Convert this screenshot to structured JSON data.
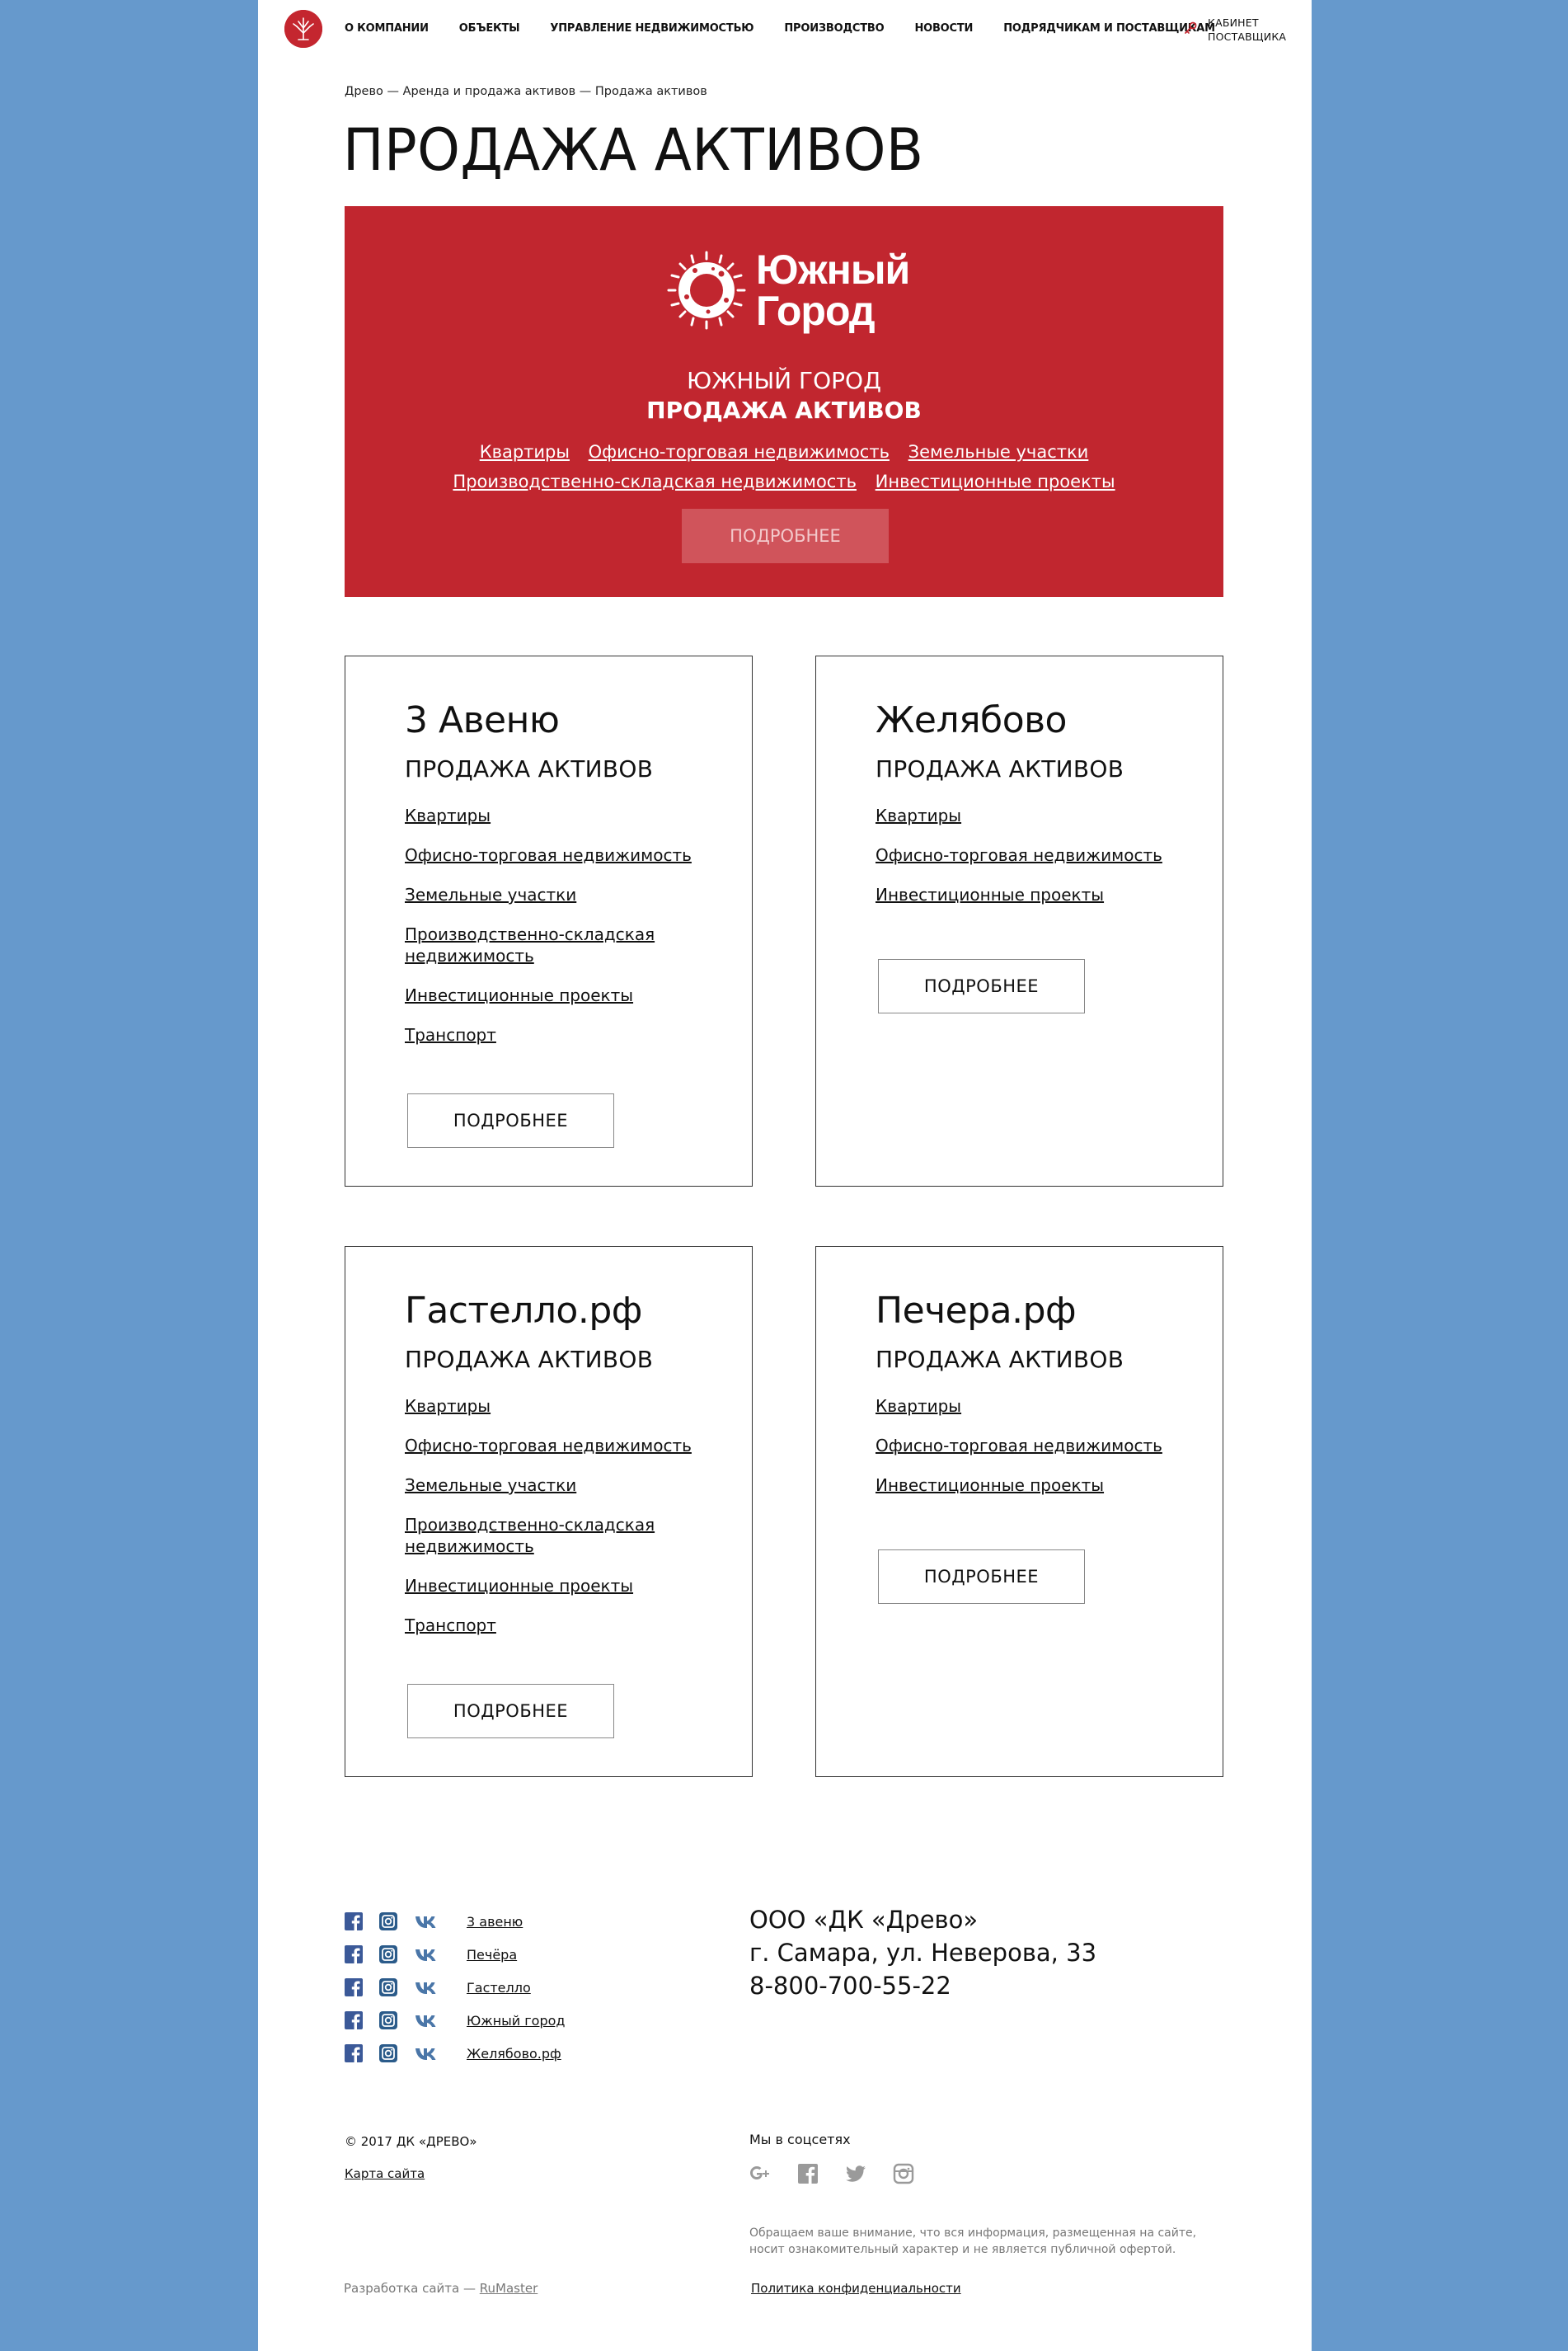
{
  "nav": {
    "items": [
      "О КОМПАНИИ",
      "ОБЪЕКТЫ",
      "УПРАВЛЕНИЕ НЕДВИЖИМОСТЬЮ",
      "ПРОИЗВОДСТВО",
      "НОВОСТИ",
      "ПОДРЯДЧИКАМ И ПОСТАВЩИКАМ"
    ],
    "cabinet_line1": "КАБИНЕТ",
    "cabinet_line2": "ПОСТАВЩИКА"
  },
  "breadcrumb": "Древо — Аренда и продажа активов — Продажа активов",
  "page_title": "ПРОДАЖА АКТИВОВ",
  "banner": {
    "logo_line1": "Южный",
    "logo_line2": "Город",
    "subtitle1": "ЮЖНЫЙ ГОРОД",
    "subtitle2": "ПРОДАЖА АКТИВОВ",
    "links_row1": [
      "Квартиры",
      "Офисно-торговая недвижимость",
      "Земельные участки"
    ],
    "links_row2": [
      "Производственно-складская недвижимость",
      "Инвестиционные проекты"
    ],
    "button": "ПОДРОБНЕЕ",
    "colors": {
      "background": "#c1262f",
      "button_bg": "#d0545b"
    }
  },
  "cards": [
    {
      "title": "3 Авеню",
      "subtitle": "ПРОДАЖА АКТИВОВ",
      "links": [
        "Квартиры",
        "Офисно-торговая недвижимость",
        "Земельные участки",
        "Производственно-складская недвижимость",
        "Инвестиционные проекты",
        "Транспорт"
      ],
      "button": "ПОДРОБНЕЕ"
    },
    {
      "title": "Желябово",
      "subtitle": "ПРОДАЖА АКТИВОВ",
      "links": [
        "Квартиры",
        "Офисно-торговая недвижимость",
        "Инвестиционные проекты"
      ],
      "button": "ПОДРОБНЕЕ"
    },
    {
      "title": "Гастелло.рф",
      "subtitle": "ПРОДАЖА АКТИВОВ",
      "links": [
        "Квартиры",
        "Офисно-торговая недвижимость",
        "Земельные участки",
        "Производственно-складская недвижимость",
        "Инвестиционные проекты",
        "Транспорт"
      ],
      "button": "ПОДРОБНЕЕ"
    },
    {
      "title": "Печера.рф",
      "subtitle": "ПРОДАЖА АКТИВОВ",
      "links": [
        "Квартиры",
        "Офисно-торговая недвижимость",
        "Инвестиционные проекты"
      ],
      "button": "ПОДРОБНЕЕ"
    }
  ],
  "footer": {
    "projects": [
      "3 авеню",
      "Печёра",
      "Гастелло",
      "Южный город",
      "Желябово.рф"
    ],
    "company_name": "ООО «ДК «Древо»",
    "company_address": "г. Самара, ул. Неверова, 33",
    "company_phone": "8-800-700-55-22",
    "copyright": "© 2017 ДК «ДРЕВО»",
    "sitemap": "Карта сайта",
    "dev_prefix": "Разработка сайта — ",
    "dev_link": "RuMaster",
    "social_title": "Мы в соцсетях",
    "social_icons": [
      "google-plus-icon",
      "facebook-icon",
      "twitter-icon",
      "instagram-icon"
    ],
    "note": "Обращаем ваше внимание, что вся информация, размещенная на сайте, носит ознакомительный характер и не является публичной офертой.",
    "privacy": "Политика конфиденциальности",
    "colors": {
      "facebook": "#3b5998",
      "instagram": "#2b5b8a",
      "vk": "#4a76a8",
      "social_gray": "#9a9a9a"
    }
  }
}
